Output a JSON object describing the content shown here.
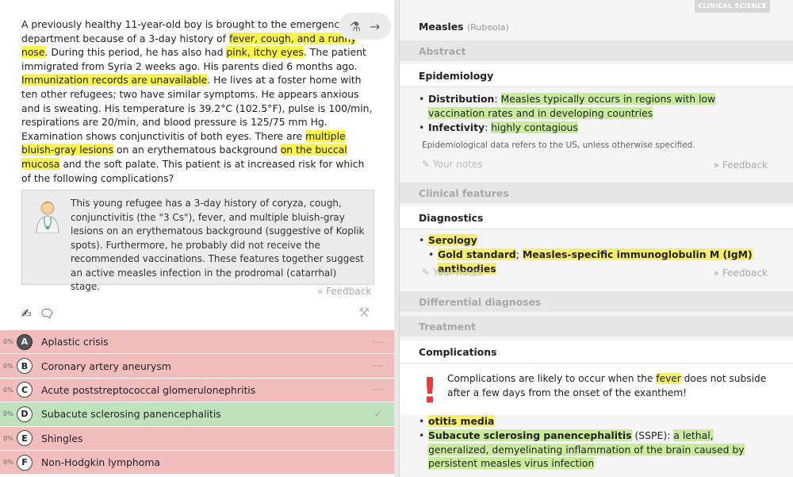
{
  "question": {
    "parts": [
      {
        "t": "A previously healthy 11-year-old boy is brought to the emergency department because of a 3-day history of ",
        "h": false
      },
      {
        "t": "fever, cough, and a runny nose",
        "h": true
      },
      {
        "t": ". During this period, he has also had ",
        "h": false
      },
      {
        "t": "pink, itchy eyes",
        "h": true
      },
      {
        "t": ". The patient immigrated from Syria 2 weeks ago. His parents died 6 months ago. ",
        "h": false
      },
      {
        "t": "Immunization records are unavailable",
        "h": true
      },
      {
        "t": ". He lives at a foster home with ten other refugees; two have similar symptoms. He appears anxious and is sweating. His temperature is 39.2°C (102.5°F), pulse is 100/min, respirations are 20/min, and blood pressure is 125/75 mm Hg. Examination shows conjunctivitis of both eyes. There are ",
        "h": false
      },
      {
        "t": "multiple bluish-gray lesions",
        "h": true
      },
      {
        "t": " on an erythematous background ",
        "h": false
      },
      {
        "t": "on the buccal mucosa",
        "h": true
      },
      {
        "t": " and the soft palate. This patient is at increased risk for which of the following complications?",
        "h": false
      }
    ]
  },
  "lab_button": {
    "flask": "⚗",
    "arrow": "→"
  },
  "explanation": "This young refugee has a 3-day history of coryza, cough, conjunctivitis (the \"3 Cs\"), fever, and multiple bluish-gray lesions on an erythematous background (suggestive of Koplik spots). Furthermore, he probably did not receive the recommended vaccinations. These features together suggest an active measles infection in the prodromal (catarrhal) stage.",
  "feedback_label": "» Feedback",
  "answers": [
    {
      "pct": "0%",
      "letter": "A",
      "text": "Aplastic crisis",
      "state": "wrong",
      "selected": true,
      "mark": "—"
    },
    {
      "pct": "0%",
      "letter": "B",
      "text": "Coronary artery aneurysm",
      "state": "wrong",
      "selected": false,
      "mark": "—"
    },
    {
      "pct": "0%",
      "letter": "C",
      "text": "Acute poststreptococcal glomerulonephritis",
      "state": "wrong",
      "selected": false,
      "mark": "—"
    },
    {
      "pct": "0%",
      "letter": "D",
      "text": "Subacute sclerosing panencephalitis",
      "state": "right",
      "selected": false,
      "mark": "✓"
    },
    {
      "pct": "0%",
      "letter": "E",
      "text": "Shingles",
      "state": "wrong",
      "selected": false,
      "mark": ""
    },
    {
      "pct": "0%",
      "letter": "F",
      "text": "Non-Hodgkin lymphoma",
      "state": "wrong",
      "selected": false,
      "mark": ""
    }
  ],
  "right": {
    "tag": "CLINICAL SCIENCE",
    "title": "Measles",
    "title_sub": "(Rubeola)",
    "sections": {
      "abstract": "Abstract",
      "epidemiology": "Epidemiology",
      "clinical_features": "Clinical features",
      "diagnostics": "Diagnostics",
      "differential": "Differential diagnoses",
      "treatment": "Treatment",
      "complications": "Complications"
    },
    "epi": {
      "distribution_label": "Distribution",
      "distribution_text": "Measles typically occurs in regions with low vaccination rates and in developing countries",
      "infectivity_label": "Infectivity",
      "infectivity_text": "highly contagious",
      "note": "Epidemiological data refers to the US, unless otherwise specified."
    },
    "diag": {
      "serology": "Serology",
      "gold_label": "Gold standard",
      "gold_text": "Measles-specific immunoglobulin M (IgM) antibodies"
    },
    "your_notes": "✎ Your notes",
    "feedback": "» Feedback",
    "warning_pre": "Complications are likely to occur when the ",
    "warning_hl": "fever",
    "warning_post": " does not subside after a few days from the onset of the exanthem!",
    "comp": {
      "otitis": "otitis media",
      "sspe_label": "Subacute sclerosing panencephalitis",
      "sspe_abbr": " (SSPE)",
      "sspe_text": "a lethal, generalized, demyelinating inflammation of the brain caused by persistent measles virus infection"
    }
  }
}
